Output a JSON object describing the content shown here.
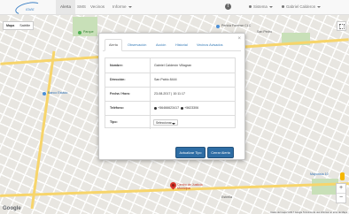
{
  "brand": {
    "text": "SMS"
  },
  "nav": {
    "items": [
      {
        "label": "Alerta",
        "active": true
      },
      {
        "label": "SMS"
      },
      {
        "label": "Vecinos"
      },
      {
        "label": "Informe"
      }
    ],
    "alert_badge": "!",
    "sistema": "Sistema",
    "user": "Gabriel Calderon"
  },
  "map": {
    "type_buttons": [
      "Mapa",
      "Satélite"
    ],
    "labels": {
      "parque": "Parque",
      "pericia": "Pericia Forense CLC",
      "san_pedro": "San Pedro",
      "banco": "Banco Estado",
      "centro": "Centro de Justicia Municipal",
      "mayorista": "Mayorista 10",
      "estrella": "Estrella"
    },
    "google": "Google",
    "attribution": "Datos del mapa ©2017 Google   Términos de uso   Informar un error de Maps",
    "zoom": [
      "+",
      "−"
    ]
  },
  "modal": {
    "tabs": [
      "Alerta",
      "Observación",
      "Acción",
      "Historial",
      "Vecinos Avisados"
    ],
    "close": "×",
    "rows": [
      {
        "label": "Nombre:",
        "value": "Gabriel Calderón Villagran"
      },
      {
        "label": "Dirección:",
        "value": "San Pablo 8444"
      },
      {
        "label": "Fecha / Hora:",
        "value": "23-08-2017 | 10:11:17"
      },
      {
        "label": "Teléfono:",
        "phone1": "+56466623417",
        "phone2": "+5623306"
      },
      {
        "label": "Tipo:",
        "select": "Seleccionar"
      }
    ],
    "buttons": {
      "update": "Actualizar Tipo",
      "close": "Cerrar Alerta"
    }
  },
  "colors": {
    "nav_bg": "#f8f8f8",
    "link": "#337ab7",
    "primary_button": "#2e6da4",
    "pin": "#d8362b",
    "park": "#c8e0b8"
  }
}
